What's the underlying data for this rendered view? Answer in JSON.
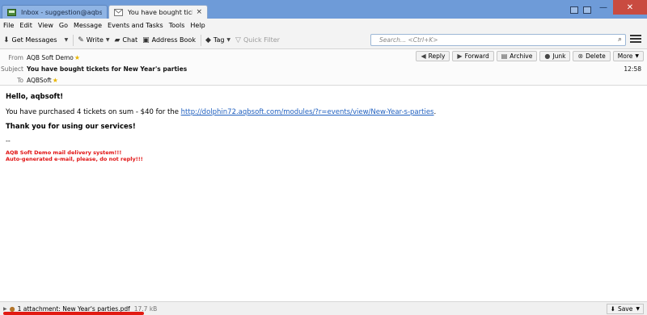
{
  "tabs": [
    {
      "label": "Inbox - suggestion@aqbsoft.c...",
      "active": false,
      "icon": "mailbox-icon"
    },
    {
      "label": "You have bought tickets f...",
      "active": true,
      "icon": "envelope-icon",
      "close": "×"
    }
  ],
  "window_controls": {
    "minimize": "—",
    "maximize": "▢",
    "close": "✕"
  },
  "menubar": {
    "items": [
      "File",
      "Edit",
      "View",
      "Go",
      "Message",
      "Events and Tasks",
      "Tools",
      "Help"
    ]
  },
  "toolbar": {
    "get_messages": "Get Messages",
    "write": "Write",
    "chat": "Chat",
    "address_book": "Address Book",
    "tag": "Tag",
    "quick_filter": "Quick Filter",
    "search_placeholder": "Search... <Ctrl+K>"
  },
  "header": {
    "from_label": "From",
    "from_value": "AQB Soft Demo",
    "subject_label": "Subject",
    "subject_value": "You have bought tickets for New Year's parties",
    "to_label": "To",
    "to_value": "AQBSoft",
    "time": "12:58",
    "actions": {
      "reply": "Reply",
      "forward": "Forward",
      "archive": "Archive",
      "junk": "Junk",
      "delete": "Delete",
      "more": "More"
    }
  },
  "message": {
    "greeting": "Hello, aqbsoft!",
    "body_prefix": "You have purchased 4 tickets on sum - $40 for the ",
    "link": "http://dolphin72.aqbsoft.com/modules/?r=events/view/New-Year-s-parties",
    "body_suffix": ".",
    "thanks": "Thank you for using our services!",
    "separator": "--",
    "signature_line1": "AQB Soft Demo mail delivery system!!!",
    "signature_line2": "Auto-generated e-mail, please, do not reply!!!"
  },
  "attachment": {
    "label": "1 attachment: New Year's parties.pdf",
    "size": "17.7 kB",
    "save": "Save"
  },
  "colors": {
    "titlebar": "#6e9bd8",
    "link": "#1f5fbf",
    "signature": "#e11212",
    "highlight_bar": "#e21a12"
  }
}
